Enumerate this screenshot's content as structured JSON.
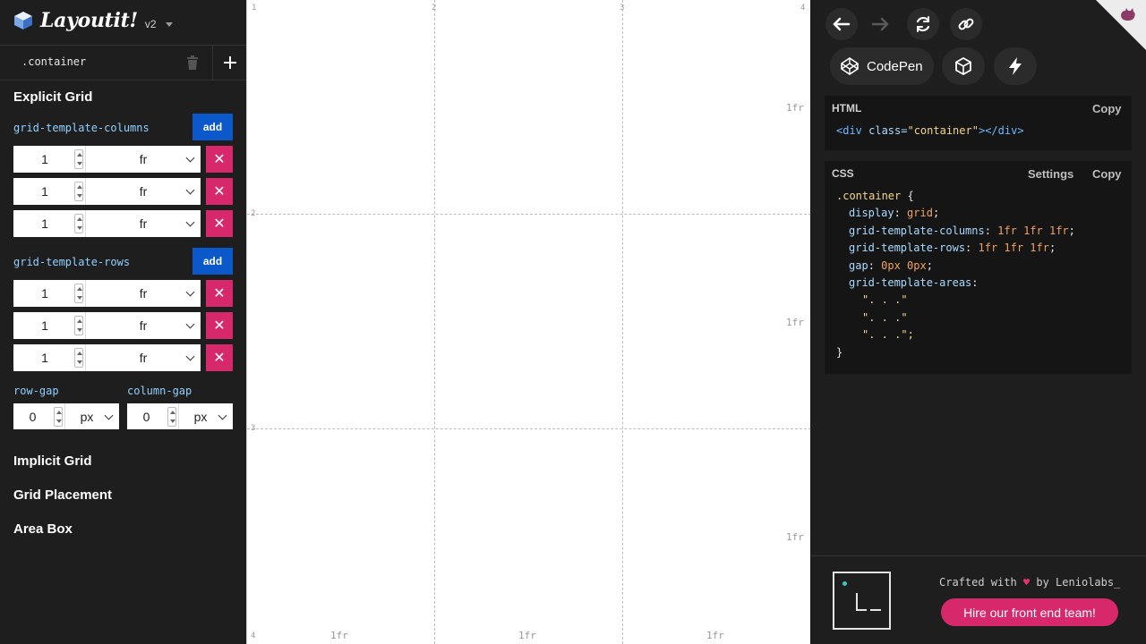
{
  "app": {
    "title": "Layoutit!",
    "version": "v2"
  },
  "sidebar": {
    "container_name": ".container",
    "explicit_title": "Explicit Grid",
    "columns_label": "grid-template-columns",
    "rows_label": "grid-template-rows",
    "add_label": "add",
    "remove_symbol": "✕",
    "columns": [
      {
        "value": "1",
        "unit": "fr"
      },
      {
        "value": "1",
        "unit": "fr"
      },
      {
        "value": "1",
        "unit": "fr"
      }
    ],
    "rows": [
      {
        "value": "1",
        "unit": "fr"
      },
      {
        "value": "1",
        "unit": "fr"
      },
      {
        "value": "1",
        "unit": "fr"
      }
    ],
    "row_gap_label": "row-gap",
    "column_gap_label": "column-gap",
    "row_gap": {
      "value": "0",
      "unit": "px"
    },
    "column_gap": {
      "value": "0",
      "unit": "px"
    },
    "implicit_title": "Implicit Grid",
    "placement_title": "Grid Placement",
    "area_title": "Area Box"
  },
  "canvas": {
    "col_lines": [
      "1",
      "2",
      "3",
      "4"
    ],
    "row_lines": [
      "2",
      "3",
      "4"
    ],
    "col_tracks": [
      "1fr",
      "1fr",
      "1fr"
    ],
    "row_tracks": [
      "1fr",
      "1fr",
      "1fr"
    ]
  },
  "toolbar": {
    "codepen_label": "CodePen"
  },
  "html_box": {
    "title": "HTML",
    "copy_label": "Copy",
    "code_open": "<div",
    "code_attr": " class=",
    "code_str": "\"container\"",
    "code_close": "></div>"
  },
  "css_box": {
    "title": "CSS",
    "settings_label": "Settings",
    "copy_label": "Copy",
    "selector": ".container",
    "brace_open": " {",
    "lines": [
      {
        "prop": "display",
        "value": "grid"
      },
      {
        "prop": "grid-template-columns",
        "value": "1fr 1fr 1fr"
      },
      {
        "prop": "grid-template-rows",
        "value": "1fr 1fr 1fr"
      },
      {
        "prop": "gap",
        "value": "0px 0px"
      }
    ],
    "areas_prop": "grid-template-areas",
    "area_rows": [
      "\". . .\"",
      "\". . .\"",
      "\". . .\";"
    ],
    "brace_close": "}"
  },
  "footer": {
    "crafted_prefix": "Crafted with ",
    "heart": "♥",
    "crafted_suffix": " by Leniolabs_",
    "hire_label": "Hire our front end team!"
  },
  "colors": {
    "accent_blue": "#0a58ca",
    "accent_pink": "#d6286b",
    "background": "#1e1e1e"
  }
}
